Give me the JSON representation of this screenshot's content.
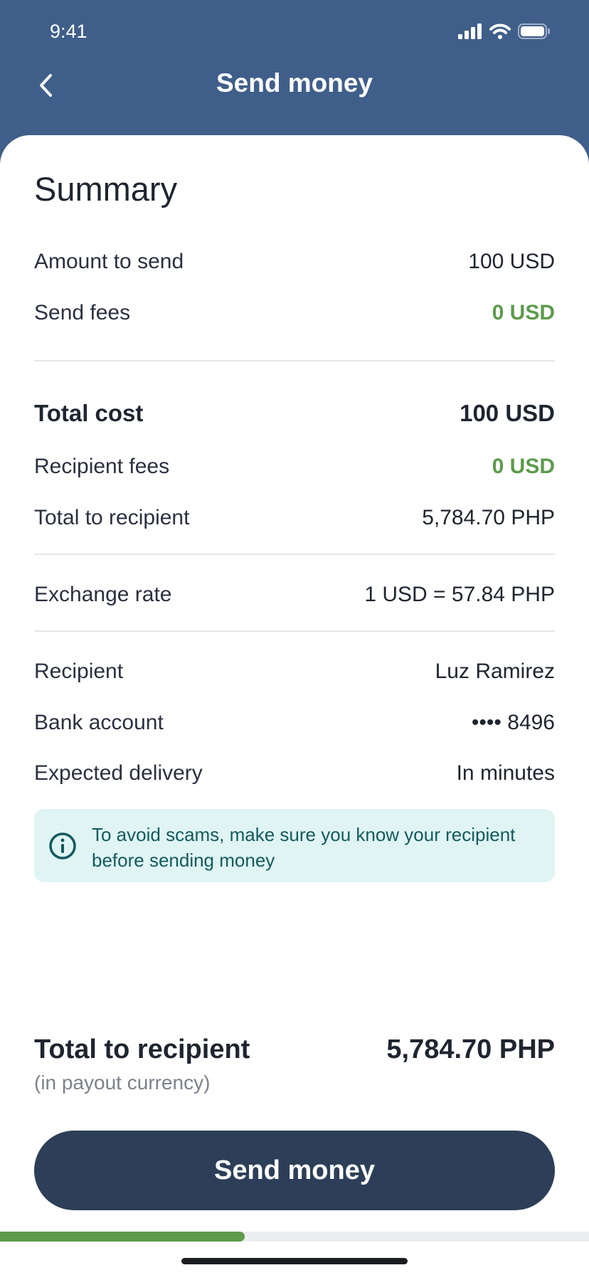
{
  "status_bar": {
    "time": "9:41"
  },
  "header": {
    "title": "Send money",
    "back_icon": "chevron-left-icon"
  },
  "summary": {
    "title": "Summary",
    "amount_to_send": {
      "label": "Amount to send",
      "value": "100 USD"
    },
    "send_fees": {
      "label": "Send fees",
      "value": "0 USD"
    },
    "total_cost": {
      "label": "Total cost",
      "value": "100 USD"
    },
    "recipient_fees": {
      "label": "Recipient fees",
      "value": "0 USD"
    },
    "total_to_recipient": {
      "label": "Total to recipient",
      "value": "5,784.70 PHP"
    },
    "exchange_rate": {
      "label": "Exchange rate",
      "value": "1 USD = 57.84 PHP"
    },
    "recipient": {
      "label": "Recipient",
      "value": "Luz Ramirez"
    },
    "bank_account": {
      "label": "Bank account",
      "value": "•••• 8496"
    },
    "expected_delivery": {
      "label": "Expected delivery",
      "value": "In minutes"
    }
  },
  "notice": {
    "icon": "info-icon",
    "text": "To avoid scams, make sure you know your recipient before sending money"
  },
  "footer": {
    "total_label": "Total to recipient",
    "total_sublabel": "(in payout currency)",
    "total_value": "5,784.70 PHP",
    "button_label": "Send money"
  },
  "progress": {
    "fraction": 0.415
  },
  "colors": {
    "header": "#3f5f8a",
    "accent_green": "#5d9b4c",
    "button": "#2d3f58",
    "notice_bg": "#e0f4f4",
    "notice_text": "#125a5e"
  }
}
